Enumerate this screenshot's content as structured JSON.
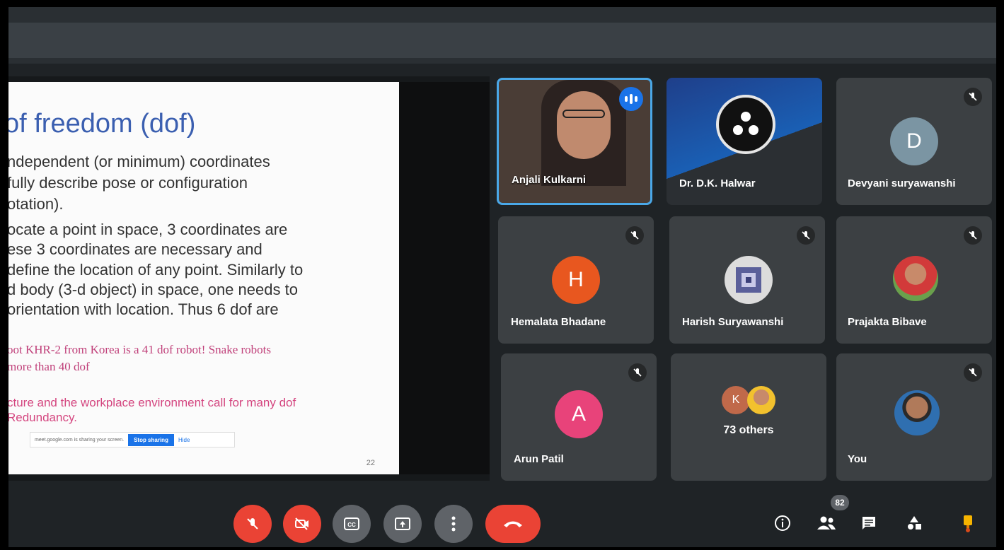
{
  "slide": {
    "title": "of freedom (dof)",
    "lines": [
      "ndependent (or minimum)  coordinates",
      "fully describe pose or configuration",
      "otation).",
      "ocate a point in space, 3 coordinates are",
      "ese 3 coordinates are necessary and",
      "define the location of any point. Similarly to",
      "d body (3-d object) in space, one needs to",
      "orientation with location. Thus 6 dof are"
    ],
    "note1": "oot KHR-2 from Korea is a 41 dof robot! Snake robots",
    "note1b": "more than 40 dof",
    "note2": "cture and the workplace environment call for many dof",
    "note2b": "Redundancy.",
    "page_number": "22",
    "share_text": "meet.google.com is sharing your screen.",
    "stop_sharing": "Stop sharing",
    "hide": "Hide"
  },
  "participants": {
    "anjali": "Anjali Kulkarni",
    "dk": "Dr. D.K. Halwar",
    "devyani": "Devyani suryawanshi",
    "devyani_initial": "D",
    "hemalata": "Hemalata Bhadane",
    "hemalata_initial": "H",
    "harish": "Harish Suryawanshi",
    "prajakta": "Prajakta Bibave",
    "arun": "Arun Patil",
    "arun_initial": "A",
    "others_initial": "K",
    "others": "73 others",
    "you": "You"
  },
  "toolbar": {
    "participant_count": "82"
  },
  "colors": {
    "accent": "#1a73e8",
    "danger": "#ea4335",
    "tile": "#3c4043",
    "avatar_h": "#e8571f",
    "avatar_a": "#e8437a",
    "avatar_d": "#7b95a3"
  }
}
